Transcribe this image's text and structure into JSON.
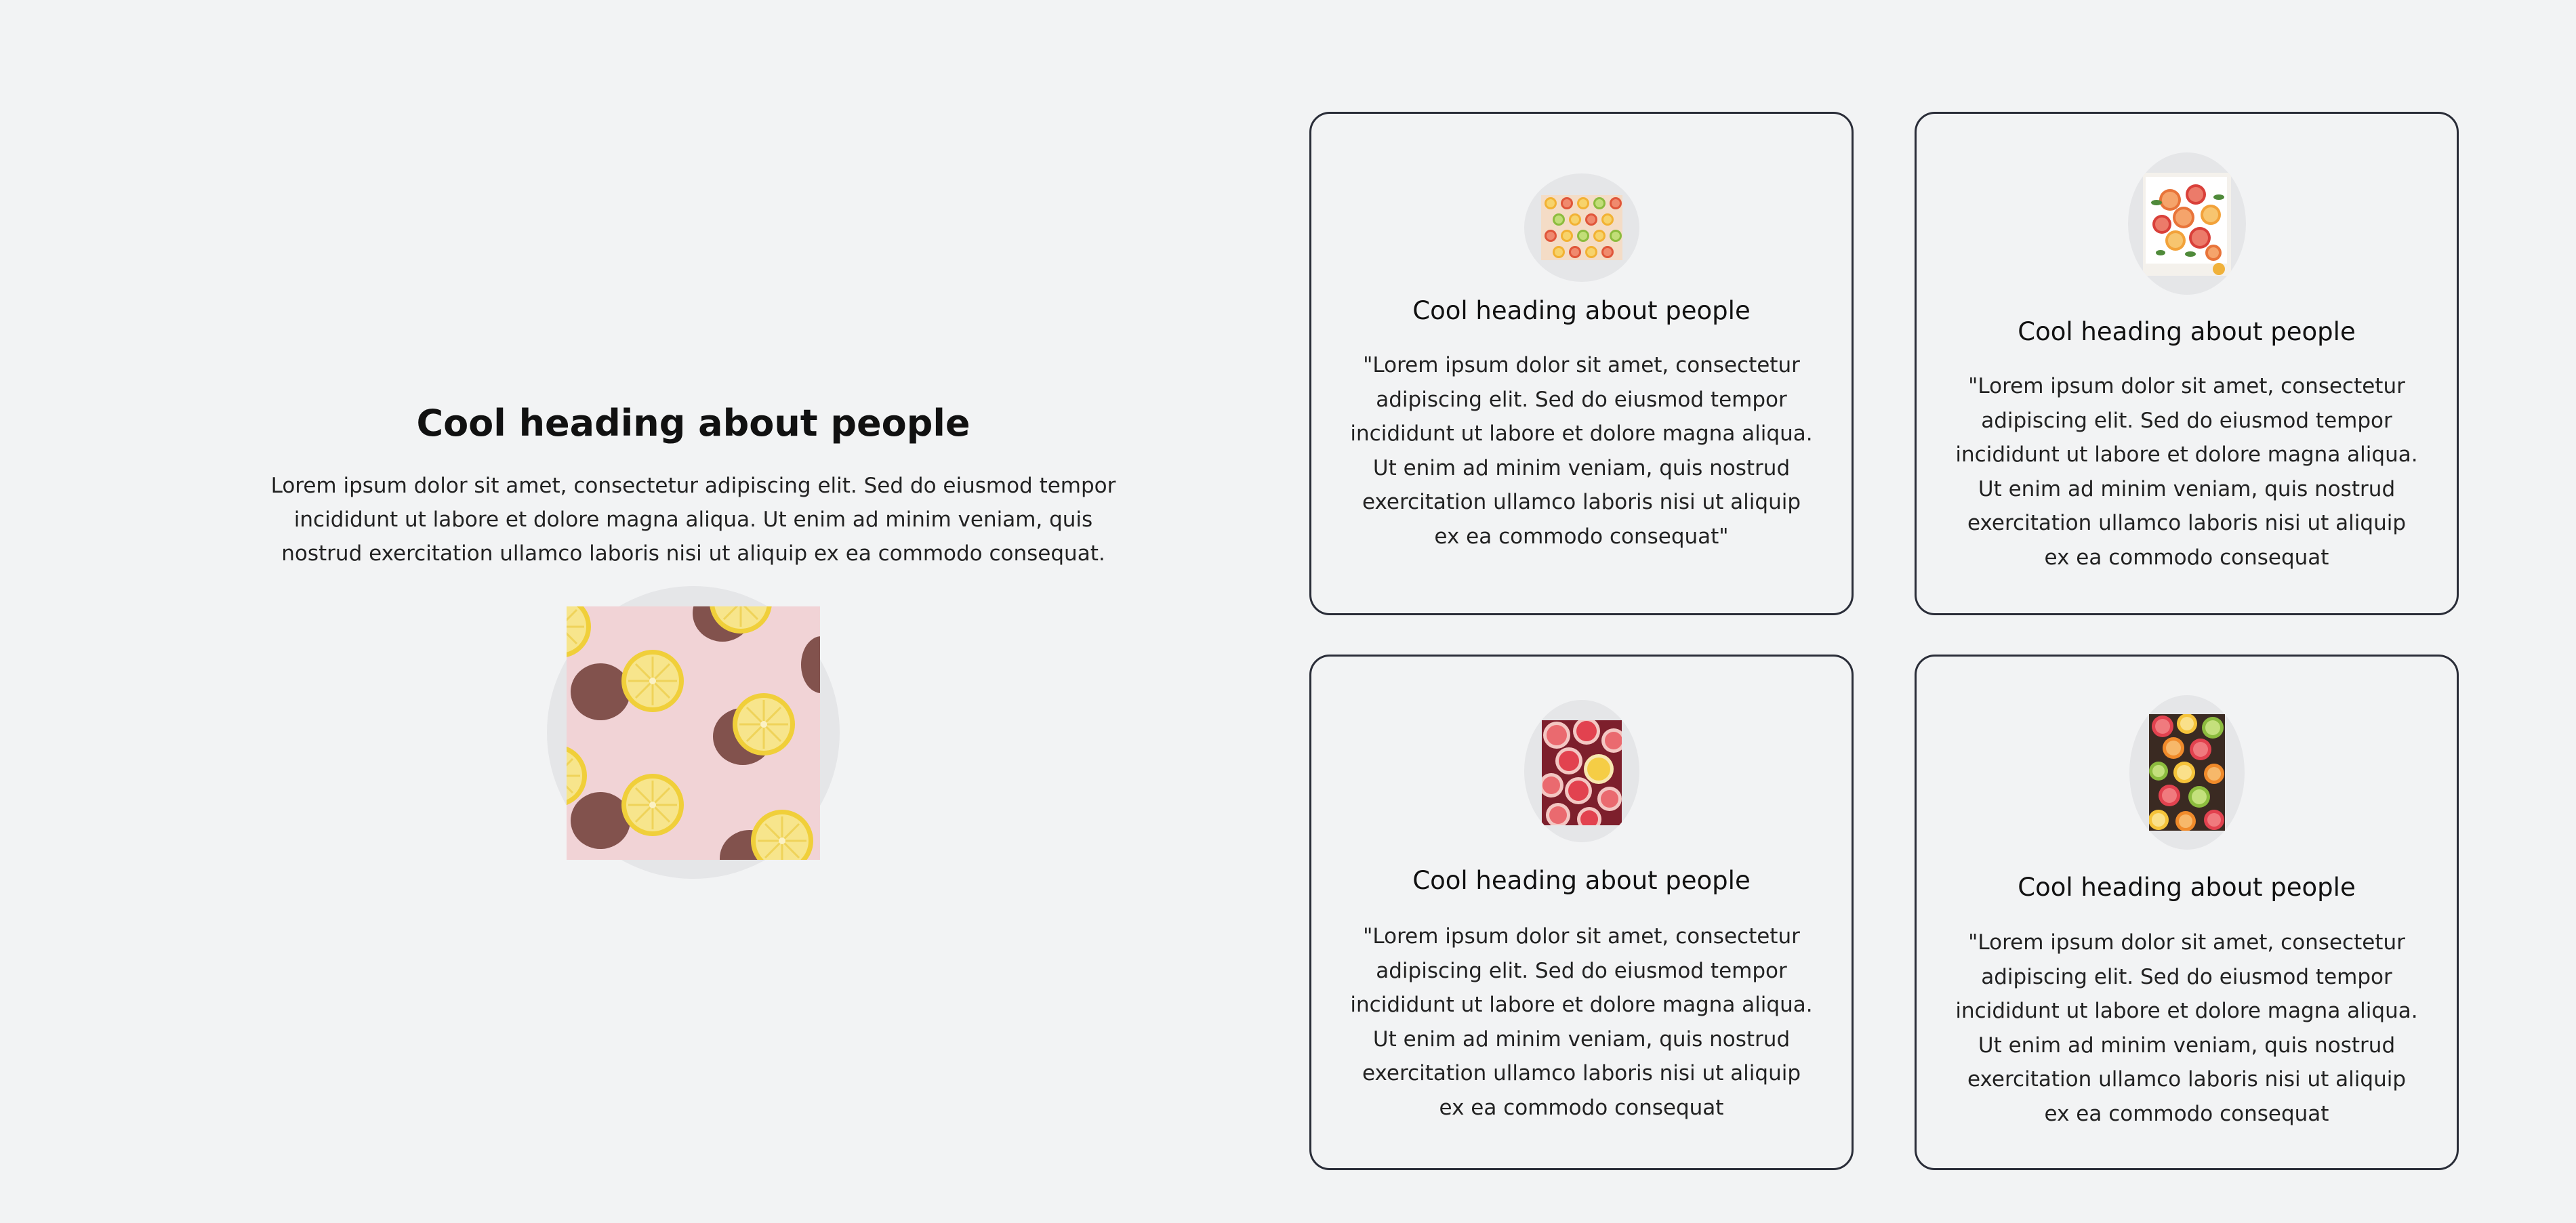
{
  "intro": {
    "heading": "Cool heading about people",
    "text": "Lorem ipsum dolor sit amet, consectetur adipiscing elit. Sed do eiusmod tempor incididunt ut labore et dolore magna aliqua. Ut enim ad minim veniam, quis nostrud exercitation ullamco laboris nisi ut aliquip ex ea commodo consequat.",
    "image": "lemon-slices-photo"
  },
  "cards": [
    {
      "heading": "Cool heading about people",
      "quote": "\"Lorem ipsum dolor sit amet, consectetur adipiscing elit. Sed do eiusmod tempor incididunt ut labore et dolore magna aliqua. Ut enim ad minim veniam, quis nostrud exercitation ullamco laboris nisi ut aliquip ex ea commodo consequat\"",
      "image": "citrus-slices-grid-photo"
    },
    {
      "heading": "Cool heading about people",
      "quote": "\"Lorem ipsum dolor sit amet, consectetur adipiscing elit. Sed do eiusmod tempor incididunt ut labore et dolore magna aliqua. Ut enim ad minim veniam, quis nostrud exercitation ullamco laboris nisi ut aliquip ex ea commodo consequat",
      "image": "citrus-platter-photo"
    },
    {
      "heading": "Cool heading about people",
      "quote": "\"Lorem ipsum dolor sit amet, consectetur adipiscing elit. Sed do eiusmod tempor incididunt ut labore et dolore magna aliqua. Ut enim ad minim veniam, quis nostrud exercitation ullamco laboris nisi ut aliquip ex ea commodo consequat",
      "image": "grapefruit-slices-photo"
    },
    {
      "heading": "Cool heading about people",
      "quote": "\"Lorem ipsum dolor sit amet, consectetur adipiscing elit. Sed do eiusmod tempor incididunt ut labore et dolore magna aliqua. Ut enim ad minim veniam, quis nostrud exercitation ullamco laboris nisi ut aliquip ex ea commodo consequat",
      "image": "mixed-citrus-slices-photo"
    }
  ],
  "colors": {
    "background": "#f2f3f4",
    "card_border": "#2a2d38",
    "avatar_circle": "#e5e6e8",
    "text": "#111111"
  }
}
